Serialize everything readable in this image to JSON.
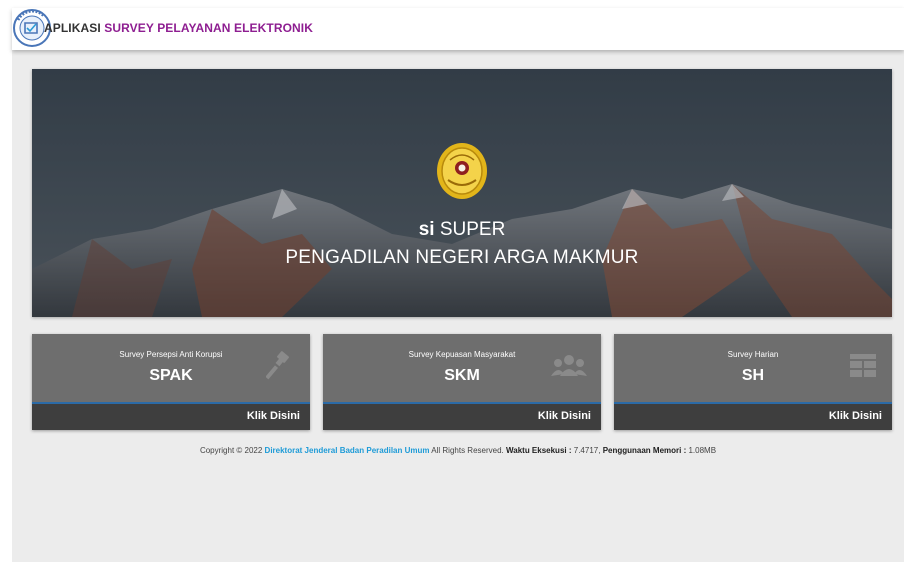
{
  "header": {
    "title_part1": "APLIKASI",
    "title_part2": "SURVEY PELAYANAN ELEKTRONIK",
    "logo_text": "SI SUPER"
  },
  "hero": {
    "brand_bold": "si",
    "brand_rest": "SUPER",
    "court_name": "PENGADILAN NEGERI ARGA MAKMUR"
  },
  "cards": [
    {
      "subtitle": "Survey Persepsi Anti Korupsi",
      "abbr": "SPAK",
      "link": "Klik Disini",
      "icon": "gavel-icon"
    },
    {
      "subtitle": "Survey Kepuasan Masyarakat",
      "abbr": "SKM",
      "link": "Klik Disini",
      "icon": "users-icon"
    },
    {
      "subtitle": "Survey Harian",
      "abbr": "SH",
      "link": "Klik Disini",
      "icon": "table-icon"
    }
  ],
  "footer": {
    "copyright": "Copyright © 2022",
    "org_link": "Direktorat Jenderal Badan Peradilan Umum",
    "rights": "All Rights Reserved.",
    "exec_label": "Waktu Eksekusi :",
    "exec_value": "7.4717,",
    "mem_label": "Penggunaan Memori :",
    "mem_value": "1.08MB"
  },
  "colors": {
    "title_accent": "#8e1e91",
    "card_bg": "#6e6e6e",
    "card_footer": "#3e3e3e",
    "link": "#1e9bd7"
  }
}
